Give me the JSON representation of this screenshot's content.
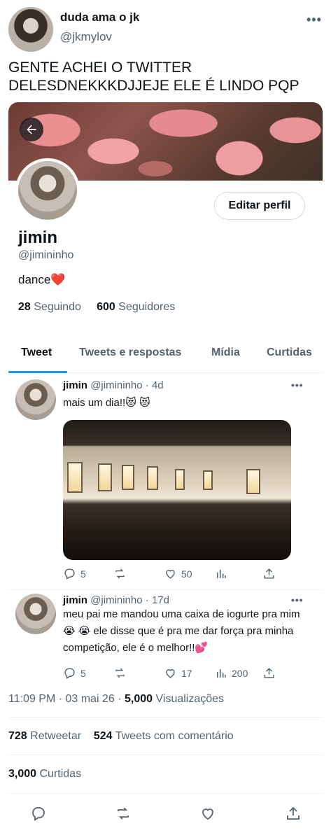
{
  "outer_tweet": {
    "display_name": "duda ama o jk",
    "handle": "@jkmylov",
    "text": "GENTE ACHEI O TWITTER DELESDNEKKKDJJEJE ELE É LINDO PQP"
  },
  "profile": {
    "edit_label": "Editar perfil",
    "name": "jimin",
    "handle": "@jimininho",
    "bio": "dance❤️",
    "following_count": "28",
    "following_label": "Seguindo",
    "followers_count": "600",
    "followers_label": "Seguidores",
    "tabs": [
      "Tweet",
      "Tweets e respostas",
      "Mídia",
      "Curtidas"
    ]
  },
  "tweets": [
    {
      "name": "jimin",
      "handle": "@jimininho",
      "age": "4d",
      "text": "mais um dia!!😻 😻",
      "replies": "5",
      "likes": "50",
      "views": ""
    },
    {
      "name": "jimin",
      "handle": "@jimininho",
      "age": "17d",
      "text": "meu pai me mandou uma caixa de iogurte pra mim😭 😭  ele disse que é pra me dar força pra minha competição, ele é o melhor!!💕",
      "replies": "5",
      "likes": "17",
      "views": "200"
    }
  ],
  "meta": {
    "time": "11:09 PM",
    "date": "03 mai 26",
    "views_count": "5,000",
    "views_label": "Visualizações",
    "retweets_count": "728",
    "retweets_label": "Retweetar",
    "quotes_count": "524",
    "quotes_label": "Tweets com comentário",
    "likes_count": "3,000",
    "likes_label": "Curtidas"
  },
  "colors": {
    "accent": "#1d9bf0",
    "muted": "#536471",
    "text": "#0f1419"
  }
}
